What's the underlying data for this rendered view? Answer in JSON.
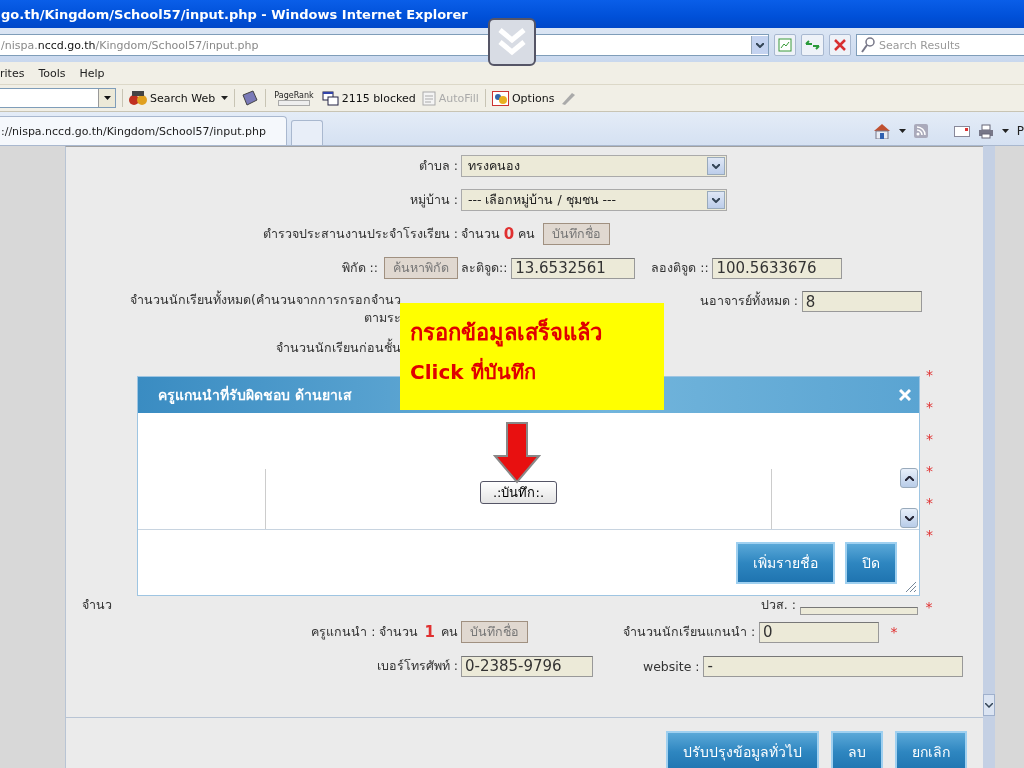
{
  "window": {
    "title": "go.th/Kingdom/School57/input.php - Windows Internet Explorer"
  },
  "address_bar": {
    "url": "/nispa.**nccd.go.th**/Kingdom/School57/input.php"
  },
  "search": {
    "placeholder": "Search Results"
  },
  "menu": [
    "rites",
    "Tools",
    "Help"
  ],
  "toolbar": {
    "search_web": "Search Web",
    "pagerank": "PageRank",
    "blocked": "2115 blocked",
    "autofill": "AutoFill",
    "options": "Options"
  },
  "tabs": [
    {
      "label": "://nispa.nccd.go.th/Kingdom/School57/input.php",
      "selected": true
    }
  ],
  "command_bar": {
    "cut_label": "P"
  },
  "form": {
    "tambon": {
      "label": "ตำบล :",
      "value": "ทรงคนอง"
    },
    "village": {
      "label": "หมู่บ้าน :",
      "value": "--- เลือกหมู่บ้าน / ชุมชน ---"
    },
    "police": {
      "label": "ตำรวจประสานงานประจำโรงเรียน :",
      "count_label": "จำนวน",
      "count": "0",
      "unit": "คน",
      "button": "บันทึกชื่อ"
    },
    "coords": {
      "label": "พิกัด ::",
      "button": "ค้นหาพิกัด",
      "lat_label": "ละติจูด::",
      "lat": "13.6532561",
      "lng_label": "ลองติจูด ::",
      "lng": "100.5633676"
    },
    "students_total": {
      "label_lines": [
        "จำนวนนักเรียนทั้งหมด(คำนวนจากการกรอกจำนว",
        "ตามระ"
      ]
    },
    "teachers_total": {
      "label": "นอาจารย์ทั้งหมด :",
      "value": "8"
    },
    "preschool": {
      "label": "จำนวนนักเรียนก่อนชั้น"
    },
    "partial_row": {
      "label": "จำนว",
      "right_label": "ปวส. :"
    },
    "leaders": {
      "label": "ครูแกนนำ : จำนวน",
      "count": "1",
      "unit": "คน",
      "button": "บันทึกชื่อ"
    },
    "leader_students": {
      "label": "จำนวนนักเรียนแกนนำ :",
      "value": "0"
    },
    "phone": {
      "label": "เบอร์โทรศัพท์ :",
      "value": "0-2385-9796"
    },
    "website": {
      "label": "website :",
      "value": "-"
    },
    "required_marks": [
      "*",
      "*",
      "*",
      "*",
      "*",
      "*",
      "*",
      "*"
    ]
  },
  "actions": [
    "ปรับปรุงข้อมูลทั่วไป",
    "ลบ",
    "ยกเลิก"
  ],
  "dialog": {
    "title": "ครูแกนนำที่รับผิดชอบ ด้านยาเส",
    "save_button": ".:บันทึก:.",
    "buttons": [
      "เพิ่มรายชื่อ",
      "ปิด"
    ]
  },
  "callout": {
    "text": "กรอกข้อมูลเสร็จแล้ว",
    "action": "**Click** ที่บันทึก"
  }
}
